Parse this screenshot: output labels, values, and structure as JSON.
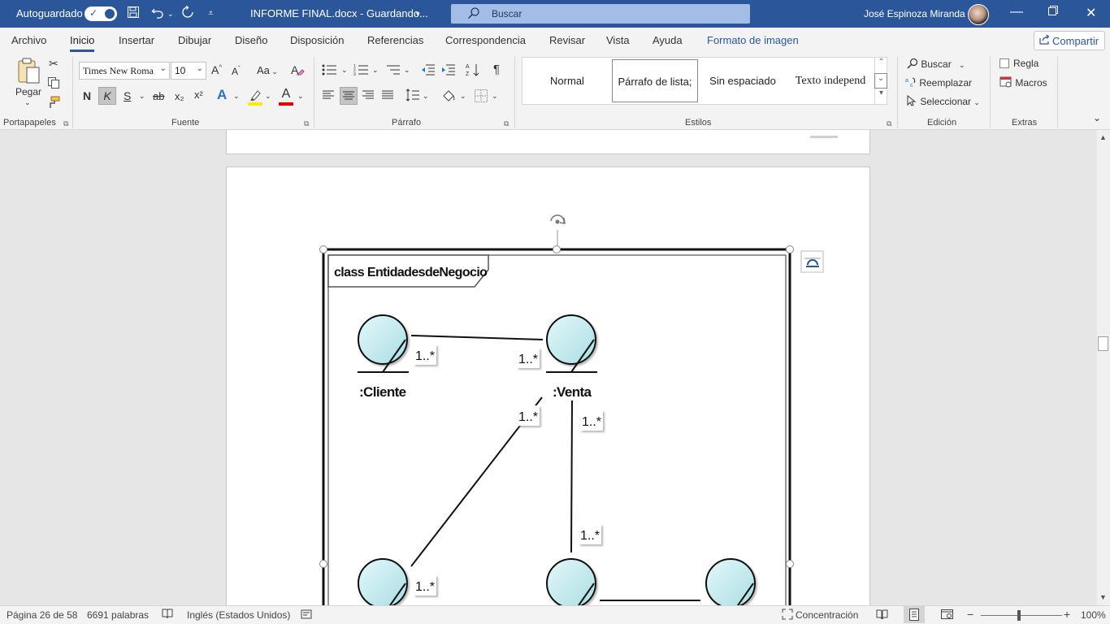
{
  "titlebar": {
    "autosave_label": "Autoguardado",
    "autosave_state": "on",
    "document_name": "INFORME FINAL.docx  -  Guardando...",
    "search_placeholder": "Buscar",
    "user_name": "José Espinoza Miranda",
    "icons": [
      "save-icon",
      "undo-icon",
      "redo-icon",
      "customize-toolbar-icon"
    ],
    "window_controls": [
      "minimize-icon",
      "restore-icon",
      "close-icon"
    ]
  },
  "ribbon_tabs": [
    {
      "label": "Archivo"
    },
    {
      "label": "Inicio",
      "active": true
    },
    {
      "label": "Insertar"
    },
    {
      "label": "Dibujar"
    },
    {
      "label": "Diseño"
    },
    {
      "label": "Disposición"
    },
    {
      "label": "Referencias"
    },
    {
      "label": "Correspondencia"
    },
    {
      "label": "Revisar"
    },
    {
      "label": "Vista"
    },
    {
      "label": "Ayuda"
    },
    {
      "label": "Formato de imagen",
      "contextual": true
    }
  ],
  "share_label": "Compartir",
  "ribbon": {
    "clipboard": {
      "paste_label": "Pegar",
      "group_label": "Portapapeles"
    },
    "font": {
      "font_name": "Times New Roma",
      "font_size": "10",
      "case_label": "Aa",
      "bold": "N",
      "italic": "K",
      "underline": "S",
      "strike": "ab",
      "subscript": "x₂",
      "superscript": "x²",
      "effects": "A",
      "font_color": "A",
      "group_label": "Fuente"
    },
    "paragraph": {
      "group_label": "Párrafo"
    },
    "styles": {
      "items": [
        "Normal",
        "Párrafo de lista;",
        "Sin espaciado",
        "Texto independ"
      ],
      "selected_index": 1,
      "group_label": "Estilos"
    },
    "editing": {
      "find": "Buscar",
      "replace": "Reemplazar",
      "select": "Seleccionar",
      "group_label": "Edición"
    },
    "extras": {
      "ruler": "Regla",
      "macros": "Macros",
      "group_label": "Extras"
    }
  },
  "diagram": {
    "frame_title": "class EntidadesdeNegocio",
    "entities": [
      ":Cliente",
      ":Venta"
    ],
    "multiplicity": "1..*"
  },
  "statusbar": {
    "page": "Página 26 de 58",
    "words": "6691 palabras",
    "language": "Inglés (Estados Unidos)",
    "focus": "Concentración",
    "zoom": "100%",
    "zoom_percent": 100
  },
  "colors": {
    "titlebar": "#2b579a",
    "entity_fill": "#c4ecf0",
    "search_box": "#a4bde6"
  }
}
